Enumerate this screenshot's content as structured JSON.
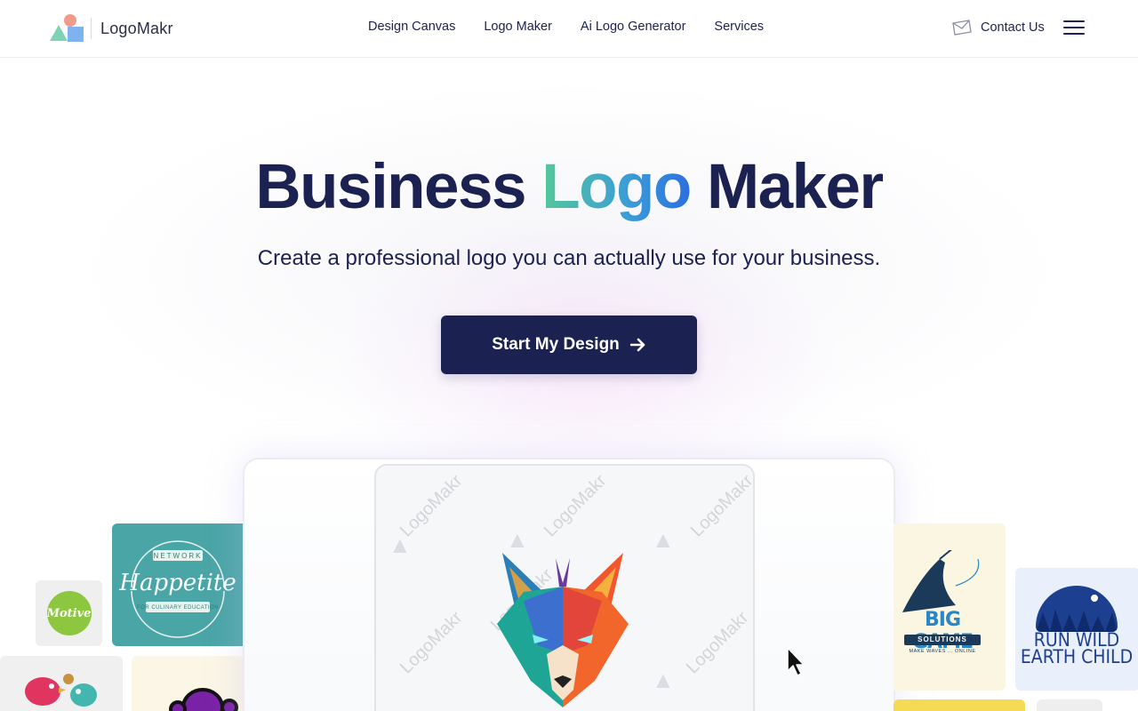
{
  "brand": {
    "name": "LogoMakr"
  },
  "nav": {
    "items": [
      {
        "label": "Design Canvas"
      },
      {
        "label": "Logo Maker"
      },
      {
        "label": "Ai Logo Generator"
      },
      {
        "label": "Services"
      }
    ]
  },
  "header": {
    "contact_label": "Contact Us"
  },
  "hero": {
    "title_before": "Business ",
    "title_accent": "Logo",
    "title_after": " Maker",
    "subtitle": "Create a professional logo you can actually use for your business.",
    "cta_label": "Start My Design"
  },
  "canvas": {
    "watermark": "LogoMakr"
  },
  "examples": {
    "motive": "Motive",
    "happetite": "Happetite",
    "happetite_network": "NETWORK",
    "happetite_tagline": "FOR CULINARY EDUCATION",
    "biggame": "BIG GAME",
    "biggame_sub": "SOLUTIONS",
    "biggame_tagline": "MAKE WAVES ... ONLINE",
    "runwild_line1": "RUN WILD",
    "runwild_line2": "EARTH CHILD"
  },
  "colors": {
    "primary": "#1b2150",
    "accent_start": "#54c89a",
    "accent_end": "#2b6fe0"
  }
}
